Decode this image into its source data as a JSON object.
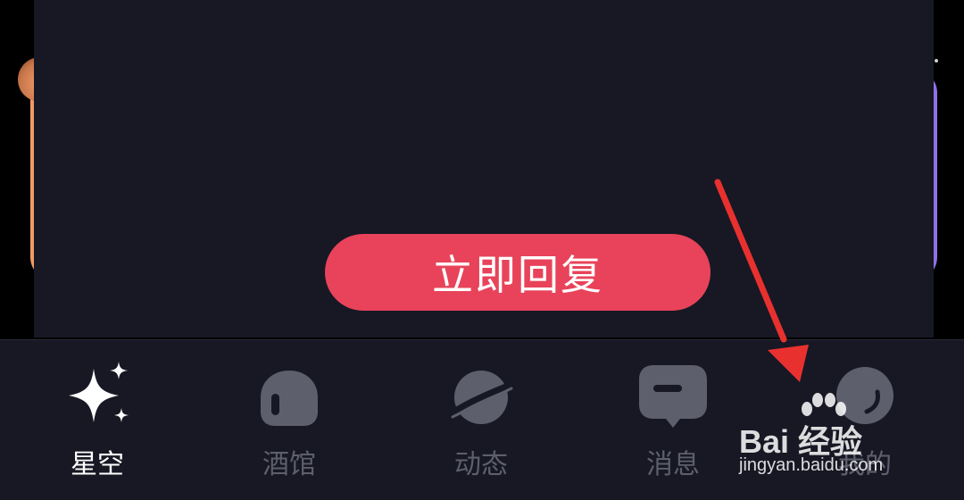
{
  "dialog": {
    "reply_button_label": "立即回复"
  },
  "tabbar": {
    "tabs": [
      {
        "label": "星空",
        "icon": "sparkle-icon",
        "active": true
      },
      {
        "label": "酒馆",
        "icon": "tavern-icon",
        "active": false
      },
      {
        "label": "动态",
        "icon": "planet-icon",
        "active": false
      },
      {
        "label": "消息",
        "icon": "message-icon",
        "active": false
      },
      {
        "label": "我的",
        "icon": "profile-icon",
        "active": false
      }
    ]
  },
  "watermark": {
    "brand": "Bai  经验",
    "url": "jingyan.baidu.com"
  },
  "colors": {
    "dialog_bg": "#171824",
    "button": "#e8435a",
    "arrow": "#e8312f",
    "inactive_tab": "#5d5f6c"
  }
}
